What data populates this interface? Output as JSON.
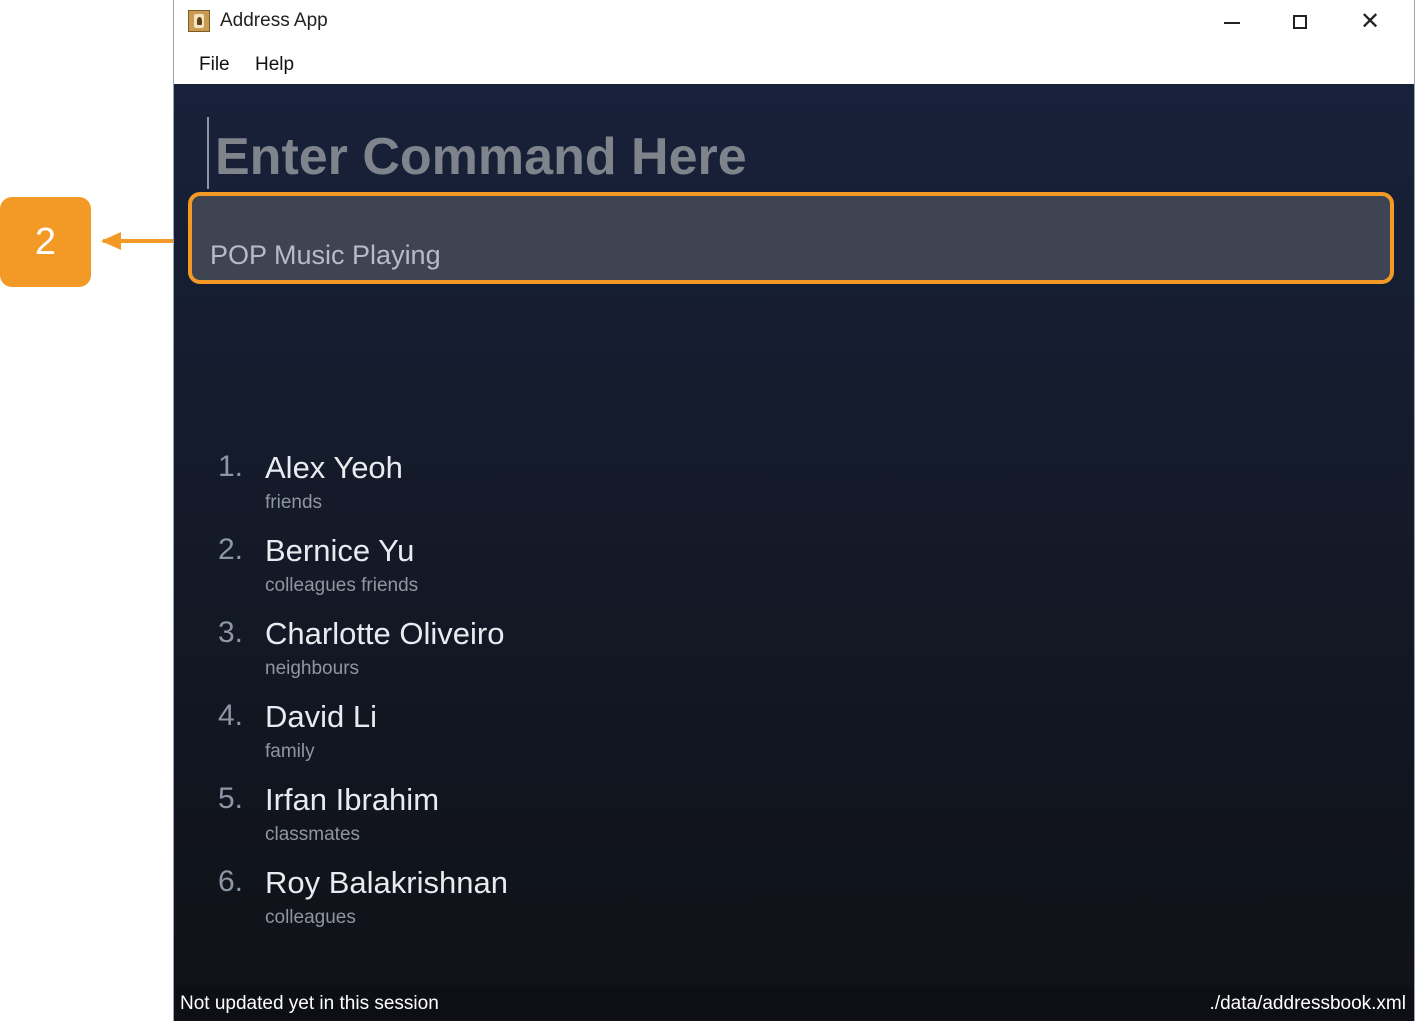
{
  "window": {
    "title": "Address App",
    "menu": [
      "File",
      "Help"
    ]
  },
  "command": {
    "placeholder": "Enter Command Here"
  },
  "result": {
    "text": "POP Music Playing"
  },
  "persons": [
    {
      "index": "1.",
      "name": "Alex Yeoh",
      "tags": "friends"
    },
    {
      "index": "2.",
      "name": "Bernice Yu",
      "tags": "colleagues  friends"
    },
    {
      "index": "3.",
      "name": "Charlotte Oliveiro",
      "tags": "neighbours"
    },
    {
      "index": "4.",
      "name": "David Li",
      "tags": "family"
    },
    {
      "index": "5.",
      "name": "Irfan Ibrahim",
      "tags": "classmates"
    },
    {
      "index": "6.",
      "name": "Roy Balakrishnan",
      "tags": "colleagues"
    }
  ],
  "status": {
    "left": "Not updated yet in this session",
    "right": "./data/addressbook.xml"
  },
  "callout": {
    "label": "2"
  },
  "colors": {
    "accent": "#f39a26",
    "background_top": "#18213a",
    "background_bottom": "#0f1116",
    "result_bg": "#3e4452"
  },
  "icons": {
    "app": "address-book-icon",
    "minimize": "minimize-icon",
    "maximize": "maximize-icon",
    "close": "close-icon"
  }
}
